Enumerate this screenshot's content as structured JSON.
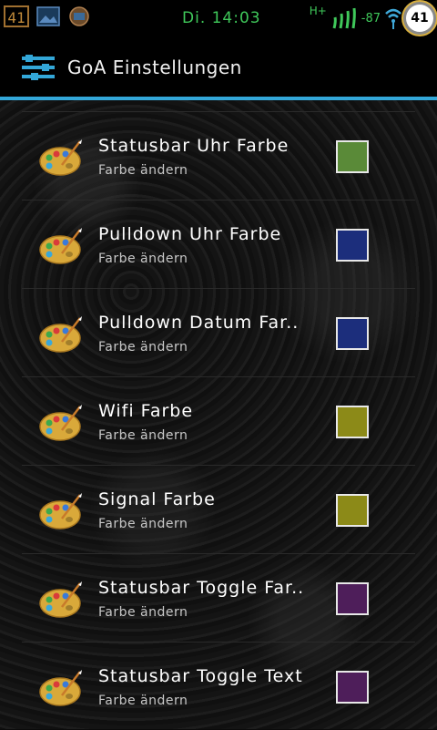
{
  "statusbar": {
    "left_badge": "41",
    "time": "Di. 14:03",
    "network": "H+",
    "signal": "-87",
    "battery": "41",
    "accent_color": "#3fc85a"
  },
  "actionbar": {
    "title": "GoA Einstellungen",
    "icon": "settings-sliders-icon",
    "underline_color": "#33a7d8"
  },
  "items": [
    {
      "title": "Statusbar Uhr Farbe",
      "subtitle": "Farbe ändern",
      "color": "#5a8a38",
      "icon": "palette-icon"
    },
    {
      "title": "Pulldown Uhr Farbe",
      "subtitle": "Farbe ändern",
      "color": "#1c2e7c",
      "icon": "palette-icon"
    },
    {
      "title": "Pulldown Datum Far..",
      "subtitle": "Farbe ändern",
      "color": "#1c2e7c",
      "icon": "palette-icon"
    },
    {
      "title": "Wifi Farbe",
      "subtitle": "Farbe ändern",
      "color": "#8c8a18",
      "icon": "palette-icon"
    },
    {
      "title": "Signal Farbe",
      "subtitle": "Farbe ändern",
      "color": "#8c8a18",
      "icon": "palette-icon"
    },
    {
      "title": "Statusbar Toggle Far..",
      "subtitle": "Farbe ändern",
      "color": "#4e1e5a",
      "icon": "palette-icon"
    },
    {
      "title": "Statusbar Toggle Text",
      "subtitle": "Farbe ändern",
      "color": "#4e1e5a",
      "icon": "palette-icon"
    }
  ]
}
